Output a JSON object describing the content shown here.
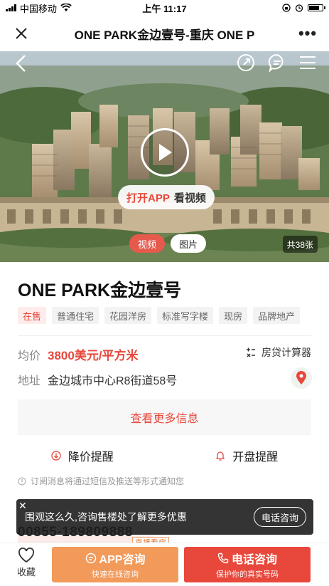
{
  "status_bar": {
    "carrier": "中国移动",
    "time": "上午 11:17",
    "battery_level": 0.85
  },
  "header": {
    "title": "ONE PARK金边壹号-重庆 ONE P",
    "more": "•••"
  },
  "hero": {
    "open_app": "打开APP",
    "watch_video": "看视频",
    "tabs": [
      "视频",
      "图片"
    ],
    "active_tab": "视频",
    "image_count": "共38张"
  },
  "property": {
    "name": "ONE PARK金边壹号",
    "tags": [
      "在售",
      "普通住宅",
      "花园洋房",
      "标准写字楼",
      "现房",
      "品牌地产"
    ],
    "price_label": "均价",
    "price_value": "3800美元/平方米",
    "calculator_label": "房贷计算器",
    "address_label": "地址",
    "address_value": "金边城市中心R8街道58号"
  },
  "actions": {
    "more_info": "查看更多信息",
    "price_alert": "降价提醒",
    "opening_alert": "开盘提醒",
    "notice": "订阅消息将通过短信及推送等形式通知您"
  },
  "phone": "00855-189809888",
  "popup": {
    "close": "✕",
    "text": "围观这么久,咨询售楼处了解更多优惠",
    "button": "电话咨询"
  },
  "live_badge": "直播看房",
  "bottom_bar": {
    "favorite": "收藏",
    "app_consult": "APP咨询",
    "app_consult_sub": "快速在线咨询",
    "phone_consult": "电话咨询",
    "phone_consult_sub": "保护你的真实号码"
  },
  "colors": {
    "accent_red": "#e8483c",
    "accent_orange": "#f29a5a"
  }
}
